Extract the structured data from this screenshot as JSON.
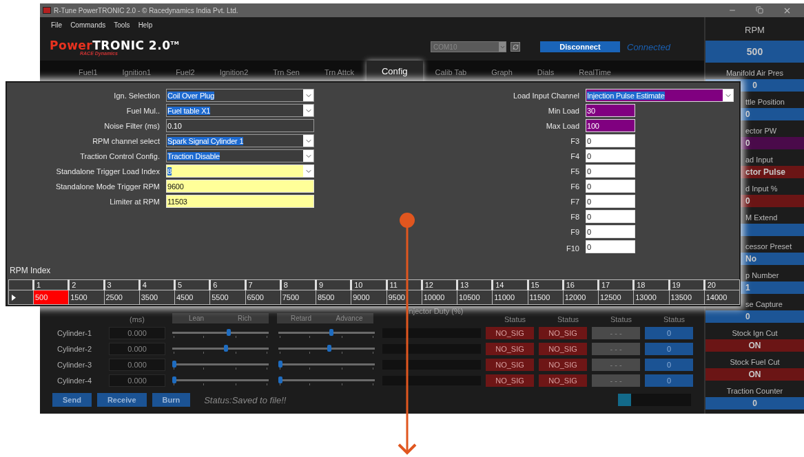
{
  "window": {
    "title": "R-Tune PowerTRONIC 2.0 - © Racedynamics India Pvt. Ltd."
  },
  "menu": [
    "File",
    "Commands",
    "Tools",
    "Help"
  ],
  "logo": {
    "parts": [
      {
        "text": "Power",
        "color": "#e8321f"
      },
      {
        "text": "TRONIC 2.0",
        "color": "#ffffff"
      }
    ],
    "mark": "TM",
    "subtitle": "RACE Dynamics"
  },
  "port": {
    "value": "COM10"
  },
  "connect_button": "Disconnect",
  "connection_status": "Connected",
  "tabs": [
    {
      "label": "Fuel1",
      "selected": false
    },
    {
      "label": "Ignition1",
      "selected": false
    },
    {
      "label": "Fuel2",
      "selected": false
    },
    {
      "label": "Ignition2",
      "selected": false
    },
    {
      "label": "Trn Sen",
      "selected": false
    },
    {
      "label": "Trn Attck",
      "selected": false
    },
    {
      "label": "Config",
      "selected": true
    },
    {
      "label": "Calib Tab",
      "selected": false
    },
    {
      "label": "Graph",
      "selected": false
    },
    {
      "label": "Dials",
      "selected": false
    },
    {
      "label": "RealTime",
      "selected": false
    }
  ],
  "config": {
    "left_fields": [
      {
        "label": "Ign. Selection",
        "value": "Coil Over Plug",
        "kind": "dropdown",
        "color": "#3c3c3c",
        "selected": true
      },
      {
        "label": "Fuel Mul..",
        "value": "Fuel table X1",
        "kind": "dropdown",
        "color": "#3c3c3c",
        "selected": true
      },
      {
        "label": "Noise Filter (ms)",
        "value": "0.10",
        "kind": "text",
        "color": "#3c3c3c",
        "selected": false
      },
      {
        "label": "RPM channel select",
        "value": "Spark Signal Cylinder 1",
        "kind": "dropdown",
        "color": "#3c3c3c",
        "selected": true
      },
      {
        "label": "Traction Control Config.",
        "value": "Traction Disable",
        "kind": "dropdown",
        "color": "#3c3c3c",
        "selected": true
      },
      {
        "label": "Standalone Trigger Load Index",
        "value": "8",
        "kind": "dropdown",
        "color": "#ffff99",
        "selected": true
      },
      {
        "label": "Standalone Mode Trigger RPM",
        "value": "9600",
        "kind": "text",
        "color": "#ffff99",
        "selected": false
      },
      {
        "label": "Limiter at RPM",
        "value": "11503",
        "kind": "text",
        "color": "#ffff99",
        "selected": false
      }
    ],
    "right_fields": [
      {
        "label": "Load Input Channel",
        "value": "Injection Pulse Estimate",
        "kind": "dropdown",
        "color": "#800080",
        "selected": true
      },
      {
        "label": "Min Load",
        "value": "30",
        "kind": "text",
        "color": "#800080",
        "selected": false
      },
      {
        "label": "Max Load",
        "value": "100",
        "kind": "text",
        "color": "#800080",
        "selected": false
      },
      {
        "label": "F3",
        "value": "0",
        "kind": "text",
        "color": "#ffffff",
        "selected": false
      },
      {
        "label": "F4",
        "value": "0",
        "kind": "text",
        "color": "#ffffff",
        "selected": false
      },
      {
        "label": "F5",
        "value": "0",
        "kind": "text",
        "color": "#ffffff",
        "selected": false
      },
      {
        "label": "F6",
        "value": "0",
        "kind": "text",
        "color": "#ffffff",
        "selected": false
      },
      {
        "label": "F7",
        "value": "0",
        "kind": "text",
        "color": "#ffffff",
        "selected": false
      },
      {
        "label": "F8",
        "value": "0",
        "kind": "text",
        "color": "#ffffff",
        "selected": false
      },
      {
        "label": "F9",
        "value": "0",
        "kind": "text",
        "color": "#ffffff",
        "selected": false
      },
      {
        "label": "F10",
        "value": "0",
        "kind": "text",
        "color": "#ffffff",
        "selected": false
      }
    ],
    "rpm_index": {
      "title": "RPM Index",
      "columns": [
        "1",
        "2",
        "3",
        "4",
        "5",
        "6",
        "7",
        "8",
        "9",
        "10",
        "11",
        "12",
        "13",
        "14",
        "15",
        "16",
        "17",
        "18",
        "19",
        "20"
      ],
      "values": [
        {
          "text": "500",
          "selected": true
        },
        {
          "text": "1500",
          "selected": false
        },
        {
          "text": "2500",
          "selected": false
        },
        {
          "text": "3500",
          "selected": false
        },
        {
          "text": "4500",
          "selected": false
        },
        {
          "text": "5500",
          "selected": false
        },
        {
          "text": "6500",
          "selected": false
        },
        {
          "text": "7500",
          "selected": false
        },
        {
          "text": "8500",
          "selected": false
        },
        {
          "text": "9000",
          "selected": false
        },
        {
          "text": "9500",
          "selected": false
        },
        {
          "text": "10000",
          "selected": false
        },
        {
          "text": "10500",
          "selected": false
        },
        {
          "text": "11000",
          "selected": false
        },
        {
          "text": "11500",
          "selected": false
        },
        {
          "text": "12000",
          "selected": false
        },
        {
          "text": "12500",
          "selected": false
        },
        {
          "text": "13000",
          "selected": false
        },
        {
          "text": "13500",
          "selected": false
        },
        {
          "text": "14000",
          "selected": false
        }
      ]
    }
  },
  "cylinder_table": {
    "pw_unit": "(ms)",
    "fuel_trim_buttons": [
      "Lean",
      "Rich"
    ],
    "ignition_trim_buttons": [
      "Retard",
      "Advance"
    ],
    "duty_header": "Injector Duty (%)",
    "status_headers": [
      "Status",
      "Status",
      "Status",
      "Status"
    ],
    "rows": [
      {
        "name": "Cylinder-1",
        "pw": "0.000",
        "fuel_trim": {
          "level": 0.59
        },
        "ignition_trim": {
          "level": 0.55
        },
        "injector": "NO_SIG",
        "ignition": "NO_SIG",
        "traction": "- - -",
        "tcu": "0"
      },
      {
        "name": "Cylinder-2",
        "pw": "0.000",
        "fuel_trim": {
          "level": 0.56
        },
        "ignition_trim": {
          "level": 0.53
        },
        "injector": "NO_SIG",
        "ignition": "NO_SIG",
        "traction": "- - -",
        "tcu": "0"
      },
      {
        "name": "Cylinder-3",
        "pw": "0.000",
        "fuel_trim": {
          "level": 0
        },
        "ignition_trim": {
          "level": 0
        },
        "injector": "NO_SIG",
        "ignition": "NO_SIG",
        "traction": "- - -",
        "tcu": "0"
      },
      {
        "name": "Cylinder-4",
        "pw": "0.000",
        "fuel_trim": {
          "level": 0
        },
        "ignition_trim": {
          "level": 0
        },
        "injector": "NO_SIG",
        "ignition": "NO_SIG",
        "traction": "- - -",
        "tcu": "0"
      }
    ]
  },
  "actions": [
    "Send",
    "Receive",
    "Burn"
  ],
  "status": "Status:Saved to file!!",
  "progress": {
    "level": 0.18
  },
  "sidebar": [
    {
      "label": "RPM",
      "value": "500",
      "color": "#1c5596",
      "cut": false
    },
    {
      "label": "Manifold Air Pres",
      "value": "0",
      "color": "#1c5596",
      "cut": false
    },
    {
      "label": "ttle Position",
      "value": "0",
      "color": "#1c5596",
      "cut": true
    },
    {
      "label": "ector PW",
      "value": "0",
      "color": "#4a0a4a",
      "cut": true
    },
    {
      "label": "ad Input",
      "value": "ctor Pulse",
      "color": "#6b1515",
      "cut": true
    },
    {
      "label": "d Input %",
      "value": "0",
      "color": "#6b1515",
      "cut": true
    },
    {
      "label": "M Extend",
      "color": "#1c5596",
      "cut": true
    },
    {
      "label": "cessor Preset",
      "value": "No",
      "color": "#1c5596",
      "cut": true
    },
    {
      "label": "p Number",
      "value": "1",
      "color": "#1c5596",
      "cut": true
    },
    {
      "label": "se Capture",
      "value": "0",
      "color": "#1c5596",
      "cut": true
    },
    {
      "label": "Stock Ign Cut",
      "value": "ON",
      "color": "#6b1515",
      "cut": false
    },
    {
      "label": "Stock Fuel Cut",
      "value": "ON",
      "color": "#6b1515",
      "cut": false
    },
    {
      "label": "Traction Counter",
      "value": "0",
      "color": "#1c5596",
      "cut": false
    }
  ]
}
